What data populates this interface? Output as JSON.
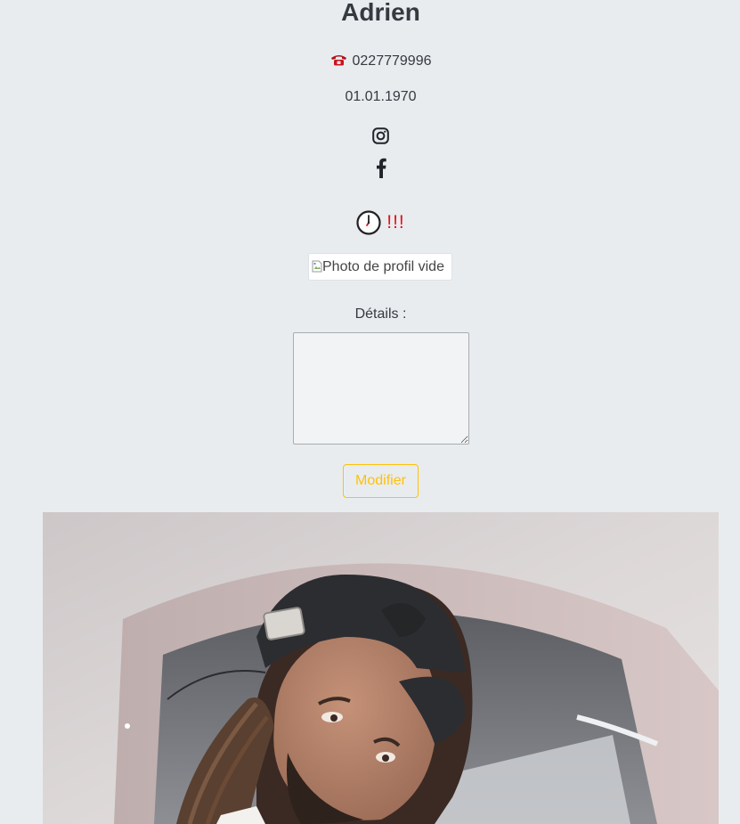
{
  "profile": {
    "name": "Adrien",
    "phone": "0227779996",
    "birth_date": "01.01.1970",
    "alert_text": "!!!",
    "profile_image_alt": "Photo de profil vide"
  },
  "social": {
    "instagram_icon": "instagram-icon",
    "facebook_icon": "facebook-icon"
  },
  "details": {
    "label": "Détails :",
    "value": ""
  },
  "actions": {
    "modify_label": "Modifier"
  },
  "colors": {
    "background": "#e9ecef",
    "alert": "#e3121b",
    "warning_outline": "#ffc107"
  }
}
